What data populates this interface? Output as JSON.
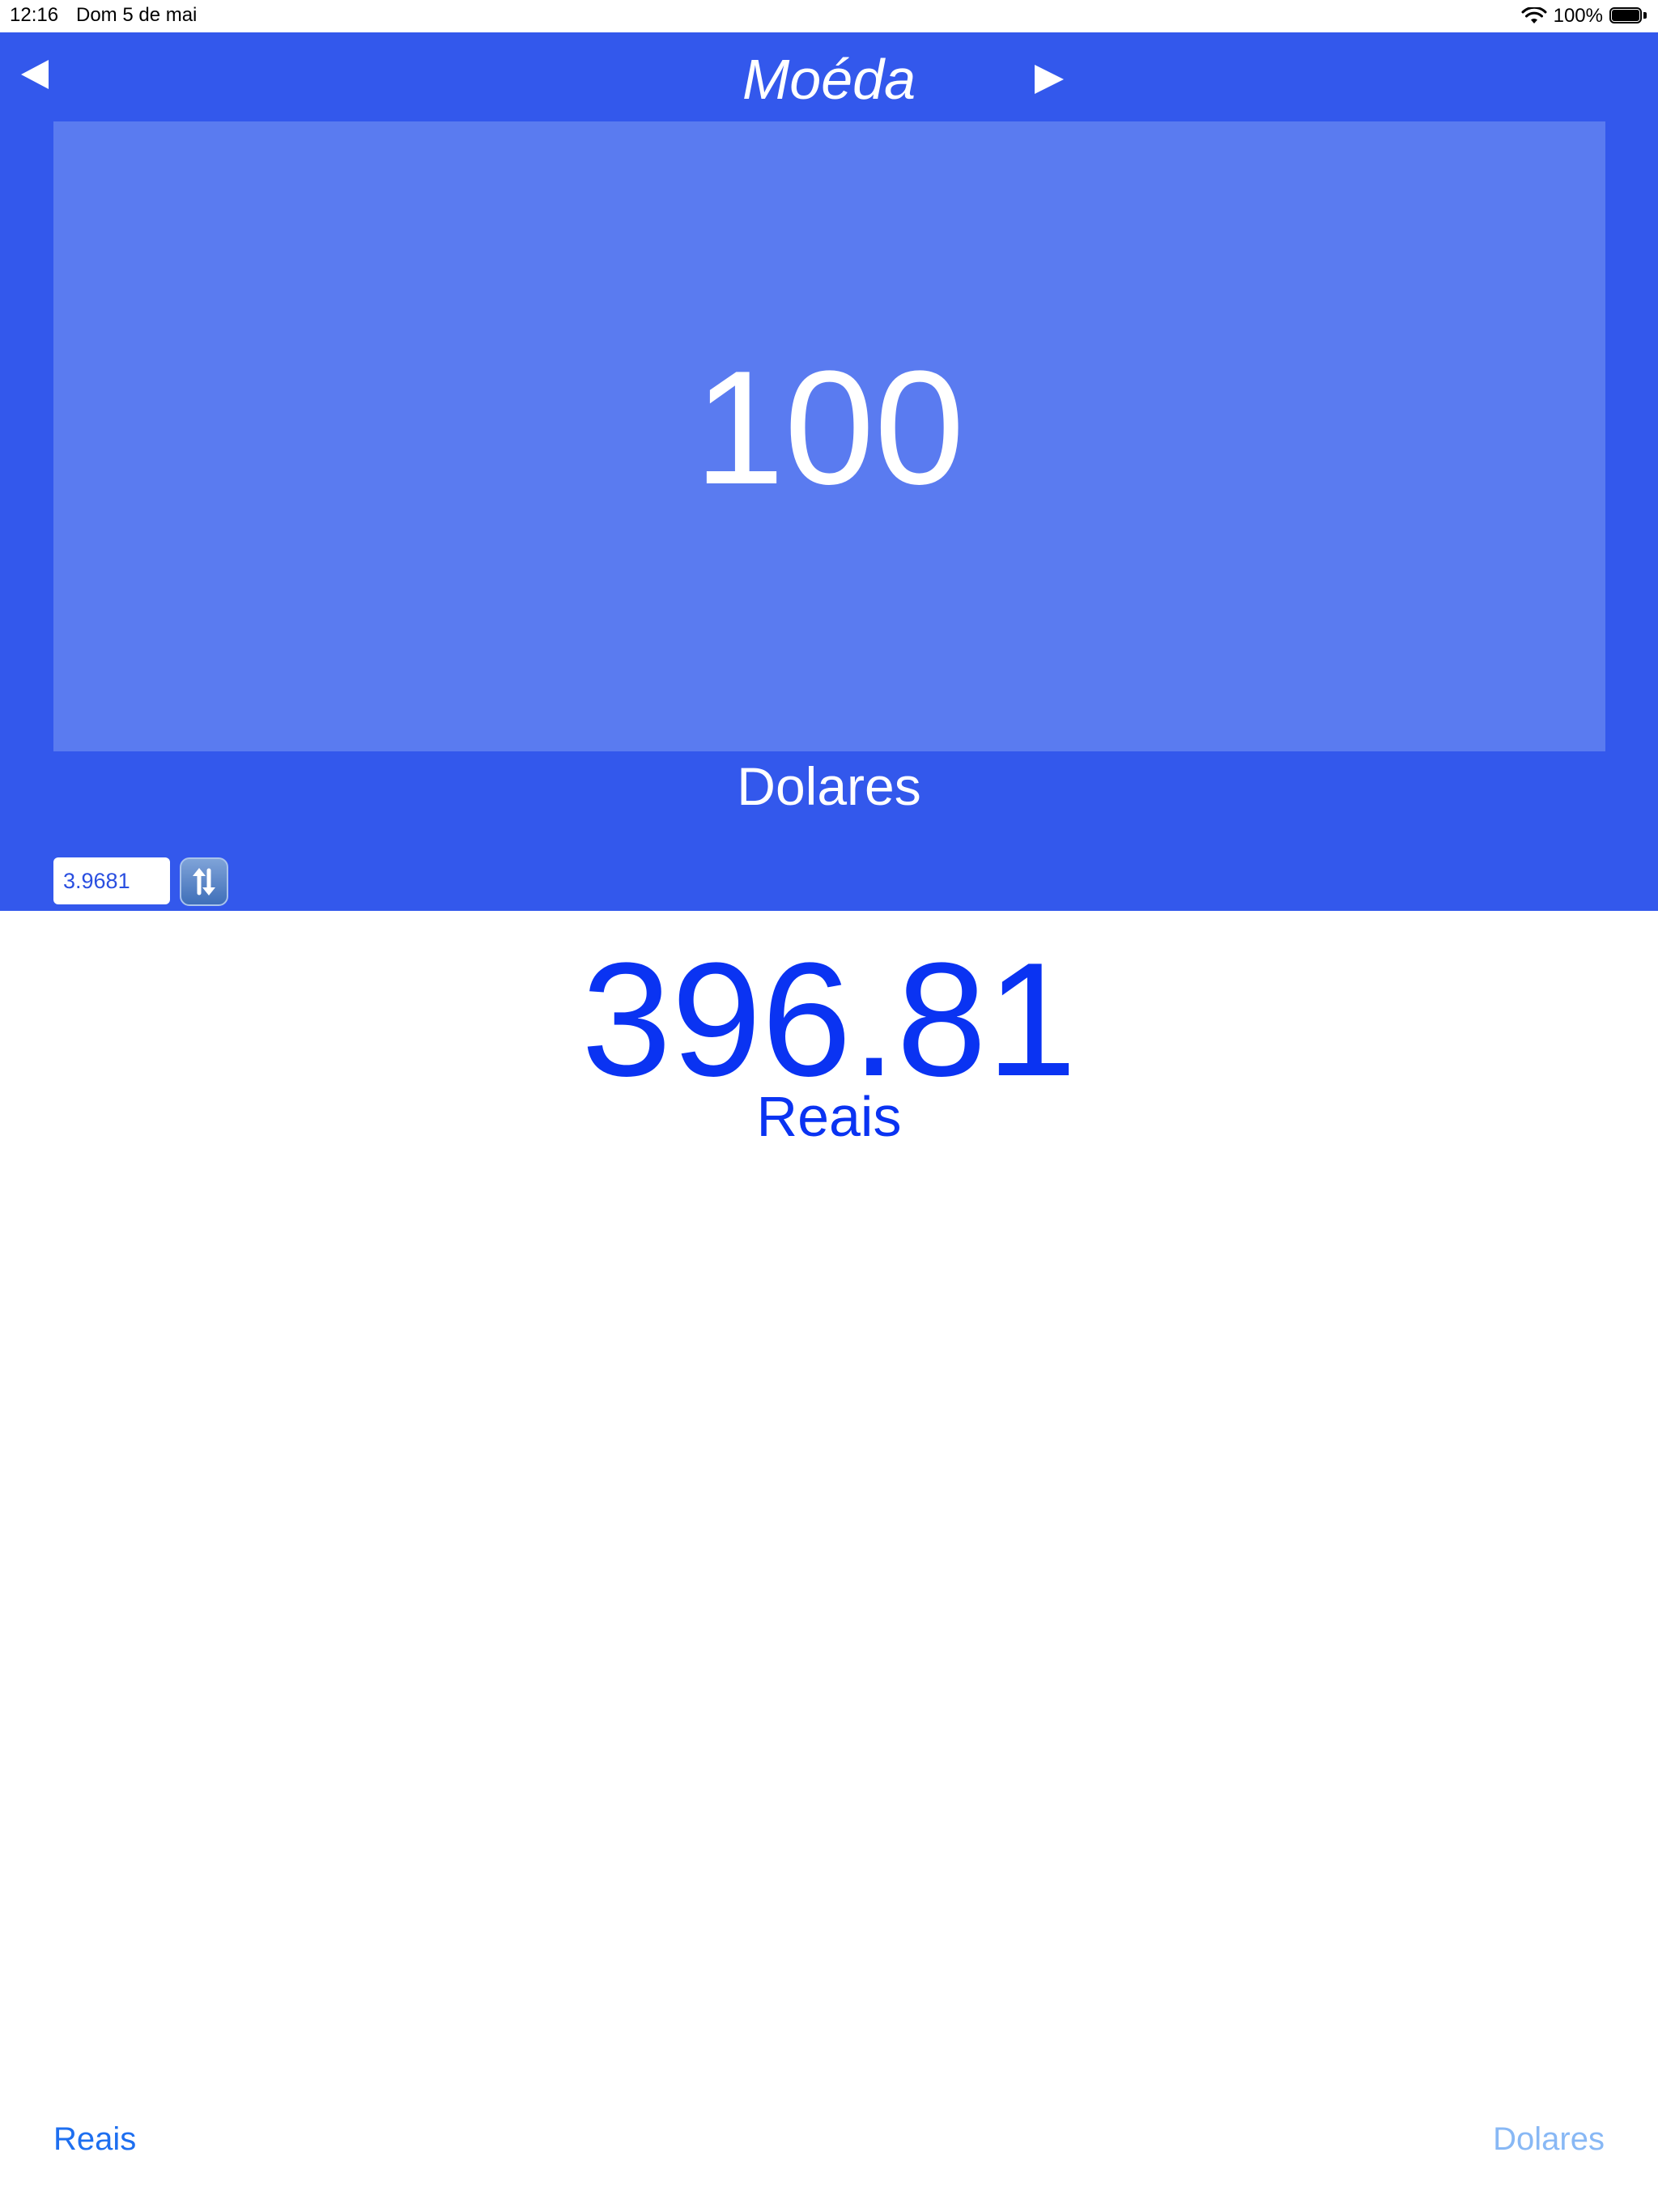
{
  "status_bar": {
    "time": "12:16",
    "date": "Dom 5 de mai",
    "battery_percent": "100%",
    "battery_level": 1.0,
    "icons": [
      "wifi-icon",
      "battery-icon"
    ]
  },
  "header": {
    "title": "Moéda",
    "back_icon": "triangle-left-icon",
    "forward_icon": "triangle-right-icon"
  },
  "converter": {
    "input_amount": "100",
    "from_currency": "Dolares",
    "rate": "3.9681",
    "swap_icon": "arrows-swap-icon",
    "result_amount": "396.81",
    "to_currency": "Reais"
  },
  "bottom_tabs": {
    "left_label": "Reais",
    "right_label": "Dolares"
  },
  "colors": {
    "panel_blue": "#3358EC",
    "amount_box": "#5A7BF0",
    "result_blue": "#0A33F2",
    "tab_active": "#1E6FF0",
    "tab_inactive": "#88B8F5"
  }
}
